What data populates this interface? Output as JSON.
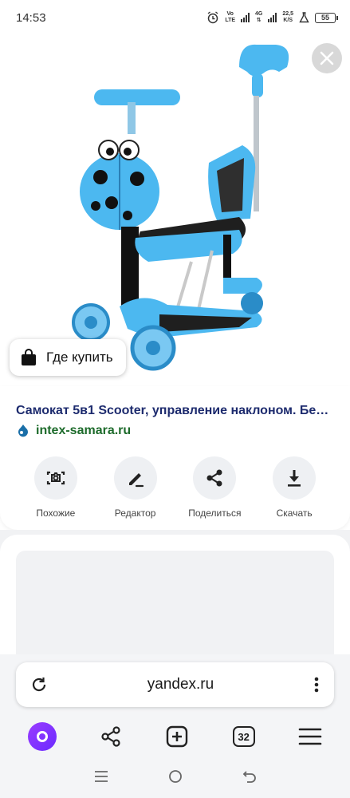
{
  "status_bar": {
    "time": "14:53",
    "volte_top": "Vo",
    "volte_bottom": "LTE",
    "network": "4G",
    "speed_value": "22,5",
    "speed_unit": "K/S",
    "battery": "55"
  },
  "image_viewer": {
    "where_to_buy_label": "Где купить"
  },
  "result": {
    "title": "Самокат 5в1 Scooter, управление наклоном. Бе…",
    "source": "intex-samara.ru"
  },
  "actions": [
    {
      "label": "Похожие",
      "icon": "camera-search-icon"
    },
    {
      "label": "Редактор",
      "icon": "pencil-icon"
    },
    {
      "label": "Поделиться",
      "icon": "share-icon"
    },
    {
      "label": "Скачать",
      "icon": "download-icon"
    }
  ],
  "address_bar": {
    "url": "yandex.ru"
  },
  "toolbar": {
    "tabs_count": "32"
  },
  "colors": {
    "title": "#1d2b6e",
    "source": "#1d6b2b",
    "scooter_blue": "#4cb8f0",
    "alice": "#7b2fff"
  }
}
